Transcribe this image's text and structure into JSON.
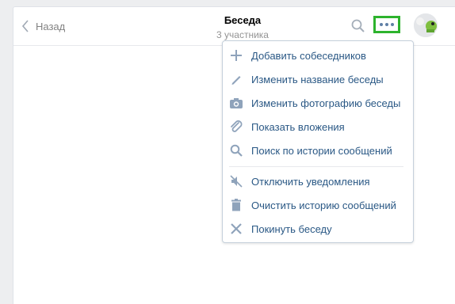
{
  "header": {
    "back_label": "Назад",
    "title": "Беседа",
    "subtitle": "3 участника"
  },
  "colors": {
    "accent": "#2a5885",
    "icon": "#8fa3bb",
    "highlight_border": "#2db32d"
  },
  "menu": {
    "items": [
      {
        "label": "Добавить собеседников",
        "icon": "plus-icon"
      },
      {
        "label": "Изменить название беседы",
        "icon": "pencil-icon"
      },
      {
        "label": "Изменить фотографию беседы",
        "icon": "camera-icon"
      },
      {
        "label": "Показать вложения",
        "icon": "paperclip-icon"
      },
      {
        "label": "Поиск по истории сообщений",
        "icon": "search-icon"
      },
      {
        "label": "Отключить уведомления",
        "icon": "mute-icon"
      },
      {
        "label": "Очистить историю сообщений",
        "icon": "trash-icon"
      },
      {
        "label": "Покинуть беседу",
        "icon": "close-icon"
      }
    ]
  }
}
